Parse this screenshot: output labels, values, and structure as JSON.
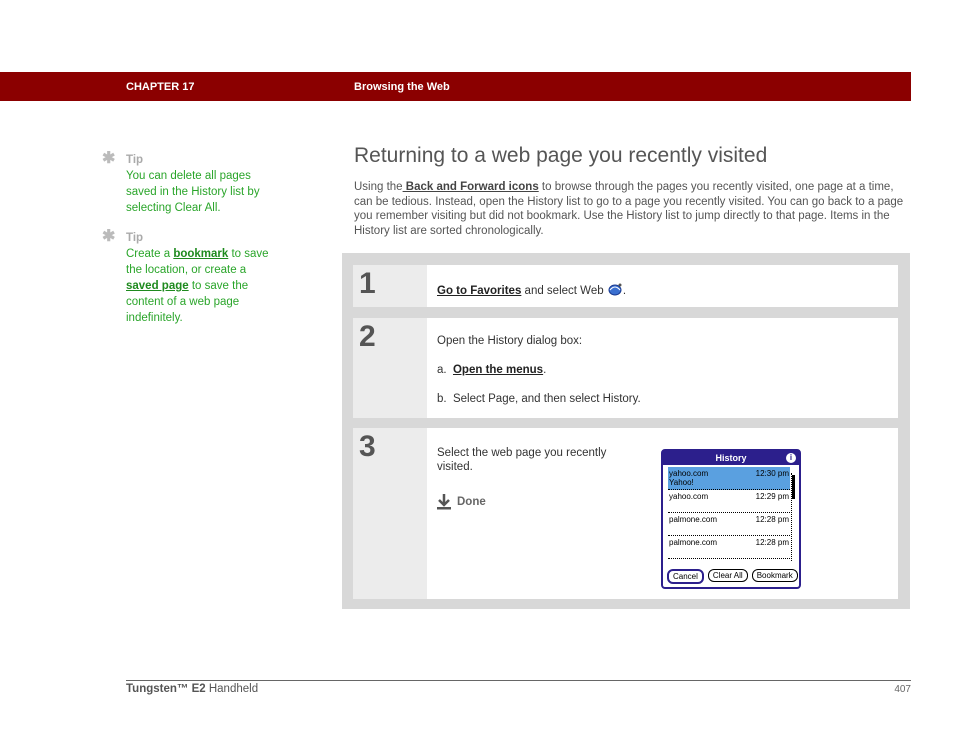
{
  "header": {
    "chapter": "CHAPTER 17",
    "section": "Browsing the Web",
    "color": "#8b0000"
  },
  "sidebar": {
    "tips": [
      {
        "icon": "asterisk-icon",
        "label": "Tip",
        "text": "You can delete all pages saved in the History list by selecting Clear All."
      },
      {
        "icon": "asterisk-icon",
        "label": "Tip",
        "text_before": "Create a ",
        "link1": "bookmark",
        "text_mid": " to save the location, or create a ",
        "link2": "saved page",
        "text_after": " to save the content of a web page indefinitely."
      }
    ]
  },
  "main": {
    "title": "Returning to a web page you recently visited",
    "intro_before": "Using the",
    "intro_link": " Back and Forward icons",
    "intro_after": " to browse through the pages you recently visited, one page at a time, can be tedious. Instead, open the History list to go to a page you recently visited. You can go back to a page you remember visiting but did not bookmark. Use the History list to jump directly to that page. Items in the History list are sorted chronologically."
  },
  "steps": [
    {
      "number": "1",
      "link": "Go to Favorites",
      "text": " and select Web ",
      "icon": "web-browser-icon",
      "tail": "."
    },
    {
      "number": "2",
      "intro": "Open the History dialog box:",
      "a_prefix": "a.",
      "a_link": "Open the menus",
      "a_tail": ".",
      "b_prefix": "b.",
      "b_text": "Select Page, and then select History."
    },
    {
      "number": "3",
      "text": "Select the web page you recently visited.",
      "done_label": "Done",
      "done_icon": "download-arrow-icon"
    }
  ],
  "history_dialog": {
    "title": "History",
    "info_icon": "info-icon",
    "items": [
      {
        "site": "yahoo.com",
        "subtitle": "Yahoo!",
        "time": "12:30 pm",
        "selected": true
      },
      {
        "site": "yahoo.com",
        "subtitle": "",
        "time": "12:29 pm",
        "selected": false
      },
      {
        "site": "palmone.com",
        "subtitle": "",
        "time": "12:28 pm",
        "selected": false
      },
      {
        "site": "palmone.com",
        "subtitle": "",
        "time": "12:28 pm",
        "selected": false
      }
    ],
    "buttons": [
      "Cancel",
      "Clear All",
      "Bookmark"
    ],
    "accent": "#2c1f8c",
    "selection_color": "#5aa0e0"
  },
  "footer": {
    "product_bold": "Tungsten™ E2",
    "product_rest": " Handheld",
    "page_number": "407"
  }
}
